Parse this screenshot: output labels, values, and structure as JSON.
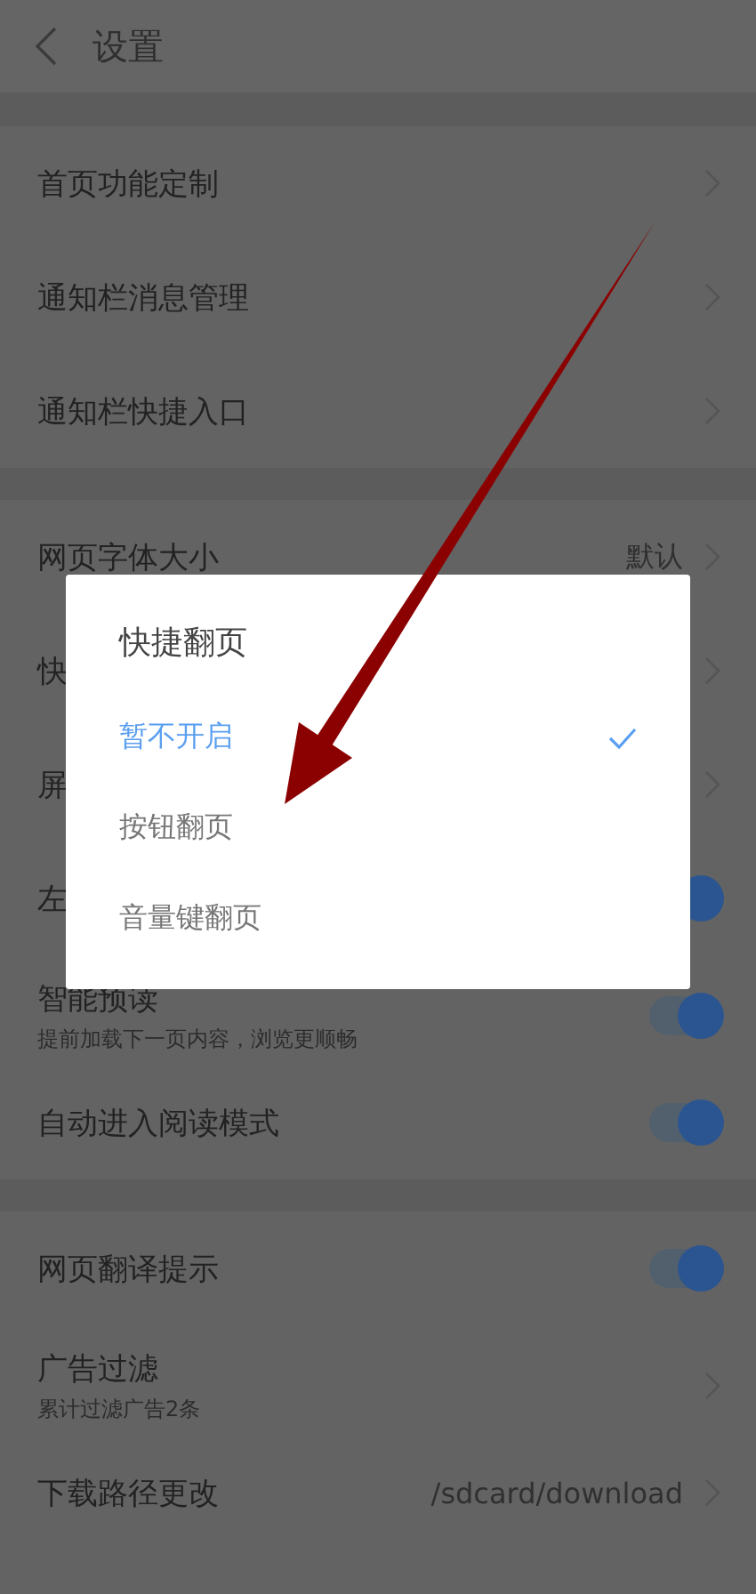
{
  "header": {
    "title": "设置"
  },
  "groups": [
    {
      "rows": [
        {
          "kind": "link",
          "label": "首页功能定制"
        },
        {
          "kind": "link",
          "label": "通知栏消息管理"
        },
        {
          "kind": "link",
          "label": "通知栏快捷入口"
        }
      ]
    },
    {
      "rows": [
        {
          "kind": "link",
          "label": "网页字体大小",
          "value": "默认"
        },
        {
          "kind": "link",
          "label": "快"
        },
        {
          "kind": "link",
          "label": "屏"
        },
        {
          "kind": "toggle",
          "label": "左",
          "on": true
        },
        {
          "kind": "toggle",
          "label": "智能预读",
          "subtitle": "提前加载下一页内容，浏览更顺畅",
          "on": true
        },
        {
          "kind": "toggle",
          "label": "自动进入阅读模式",
          "on": true
        }
      ]
    },
    {
      "rows": [
        {
          "kind": "toggle",
          "label": "网页翻译提示",
          "on": true
        },
        {
          "kind": "link",
          "label": "广告过滤",
          "subtitle": "累计过滤广告2条"
        },
        {
          "kind": "link",
          "label": "下载路径更改",
          "value": "/sdcard/download"
        }
      ]
    }
  ],
  "dialog": {
    "title": "快捷翻页",
    "options": [
      {
        "label": "暂不开启",
        "selected": true
      },
      {
        "label": "按钮翻页",
        "selected": false
      },
      {
        "label": "音量键翻页",
        "selected": false
      }
    ]
  }
}
